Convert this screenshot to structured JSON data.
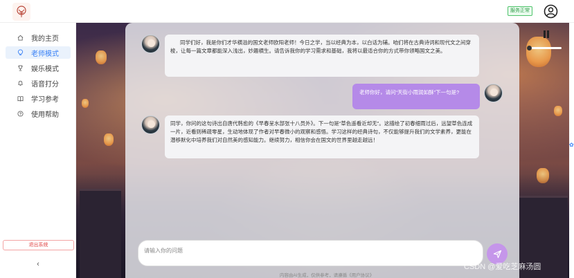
{
  "header": {
    "status_badge": "服务正常"
  },
  "sidebar": {
    "items": [
      {
        "label": "我的主页",
        "icon": "home-icon"
      },
      {
        "label": "老师模式",
        "icon": "bulb-icon",
        "active": true
      },
      {
        "label": "娱乐模式",
        "icon": "trophy-icon"
      },
      {
        "label": "语音打分",
        "icon": "bell-icon"
      },
      {
        "label": "学习参考",
        "icon": "book-icon"
      },
      {
        "label": "使用帮助",
        "icon": "help-icon"
      }
    ],
    "logout_label": "退出系统",
    "collapse_label": "‹"
  },
  "chat": {
    "messages": [
      {
        "role": "assistant",
        "text": "同学们好，我是你们才华横溢的国文老师欧阳老师！今日之学，当以经典为本，以白话为辅。咱们将在古典诗词和现代文之间穿梭，让每一篇文章都能深入浅出，妙趣横生。请告诉我你的学习需求和基础，我将以最适合你的方式带你领略国文之美。"
      },
      {
        "role": "user",
        "text": "老师你好，请问“天街小雨润如酥”下一句是?"
      },
      {
        "role": "assistant",
        "text": "同学，你问的这句诗出自唐代韩愈的《早春呈水部张十八员外》。下一句是“草色遥看近却无”。这描绘了初春细雨过后，远望草色连成一片，近看则稀疏零星，生动地体现了作者对早春微小的观察和感悟。学习这样的经典诗句，不仅能够提升我们的文学素养，更能在潜移默化中培养我们对自然美的感知能力。继续努力，相信你会在国文的世界里越走越远！"
      }
    ],
    "input_placeholder": "请输入你的问题",
    "footer_note": "内容由AI生成，仅供参考，请遵循《用户协议》"
  },
  "watermark": "CSDN @爱吃芝麻汤圆",
  "colors": {
    "accent": "#3b82f6",
    "user_bubble": "#b58ae8",
    "send_button": "#c596ea",
    "status_green": "#2e9c48",
    "logout_red": "#e04848"
  }
}
